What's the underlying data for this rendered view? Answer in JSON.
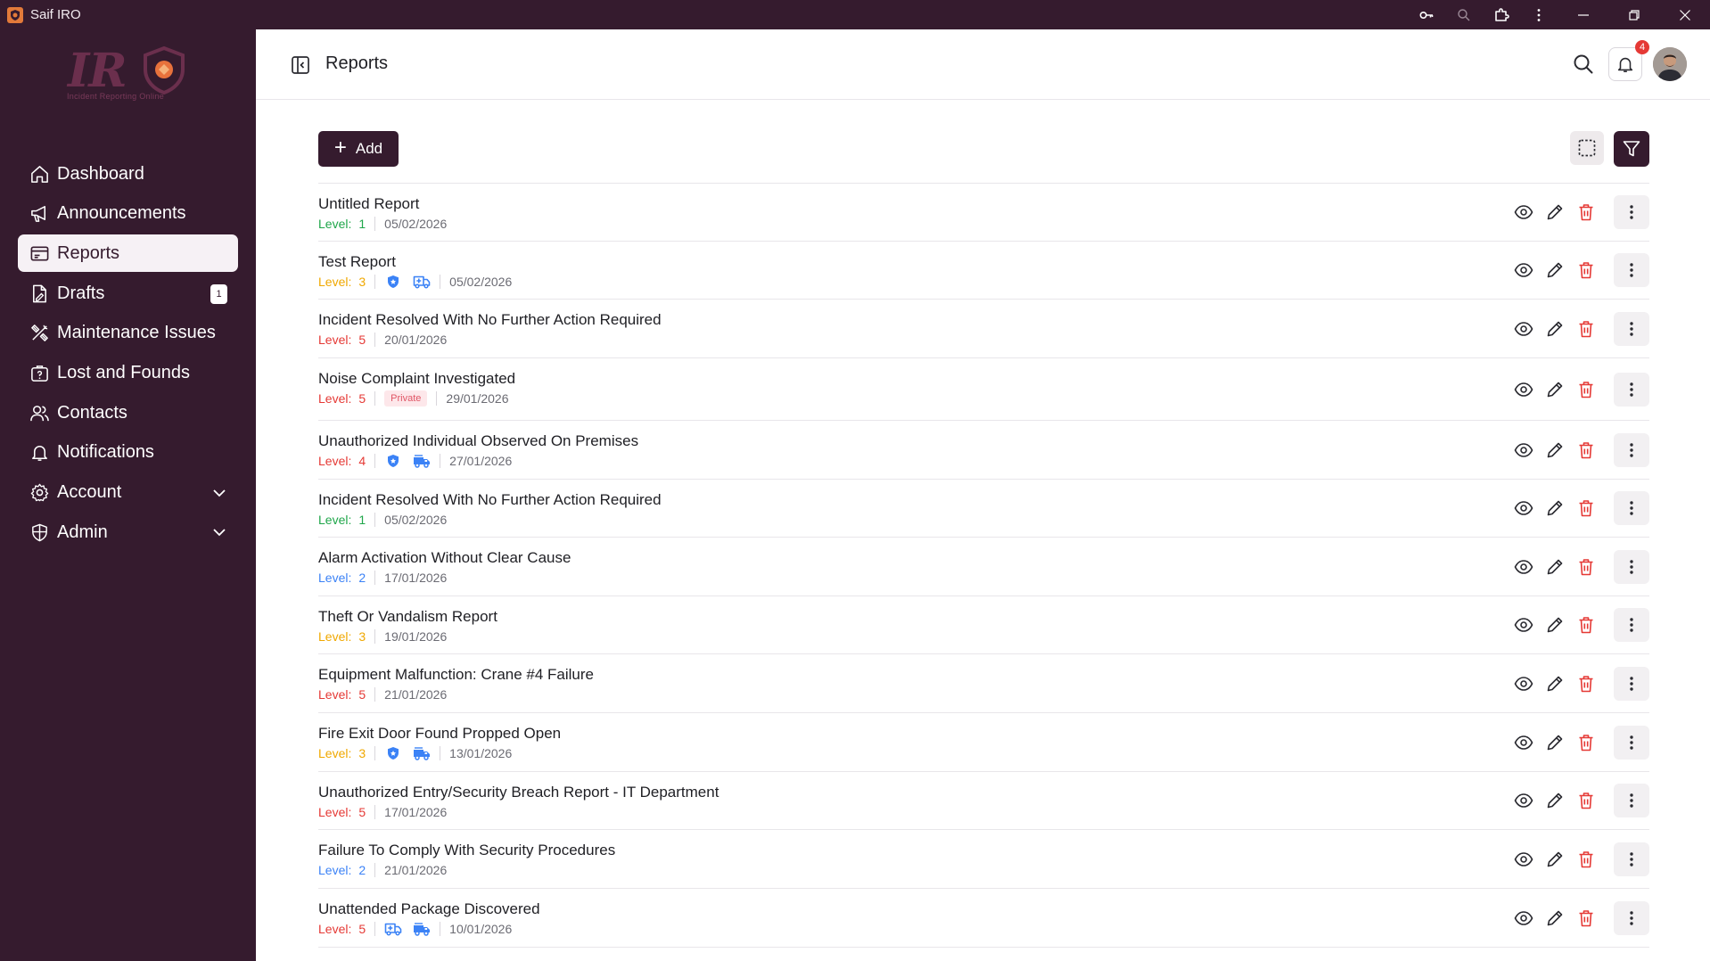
{
  "window": {
    "title": "Saif IRO"
  },
  "logo": {
    "text": "IR",
    "subtitle": "Incident Reporting Online"
  },
  "nav": {
    "items": [
      {
        "label": "Dashboard",
        "icon": "home-icon"
      },
      {
        "label": "Announcements",
        "icon": "megaphone-icon"
      },
      {
        "label": "Reports",
        "icon": "report-card-icon",
        "active": true
      },
      {
        "label": "Drafts",
        "icon": "draft-file-icon",
        "badge": "1"
      },
      {
        "label": "Maintenance Issues",
        "icon": "tools-icon"
      },
      {
        "label": "Lost and Founds",
        "icon": "question-bag-icon"
      },
      {
        "label": "Contacts",
        "icon": "users-icon"
      },
      {
        "label": "Notifications",
        "icon": "bell-icon"
      },
      {
        "label": "Account",
        "icon": "gear-icon",
        "expandable": true
      },
      {
        "label": "Admin",
        "icon": "shield-icon",
        "expandable": true
      }
    ]
  },
  "header": {
    "title": "Reports",
    "notification_count": "4"
  },
  "toolbar": {
    "add_label": "Add"
  },
  "level_label": "Level:",
  "colors": {
    "brand": "#351b2e",
    "level_1": "#1fa64a",
    "level_2": "#3b82f6",
    "level_3": "#f0a800",
    "level_4": "#e53935",
    "level_5": "#e53935",
    "delete": "#e53935"
  },
  "reports": [
    {
      "title": "Untitled Report",
      "level": "1",
      "date": "05/02/2026",
      "icons": [],
      "private": false
    },
    {
      "title": "Test Report",
      "level": "3",
      "date": "05/02/2026",
      "icons": [
        "police-shield-icon",
        "ambulance-icon"
      ],
      "private": false
    },
    {
      "title": "Incident Resolved With No Further Action Required",
      "level": "5",
      "date": "20/01/2026",
      "icons": [],
      "private": false
    },
    {
      "title": "Noise Complaint Investigated",
      "level": "5",
      "date": "29/01/2026",
      "icons": [],
      "private": true,
      "private_label": "Private"
    },
    {
      "title": "Unauthorized Individual Observed On Premises",
      "level": "4",
      "date": "27/01/2026",
      "icons": [
        "police-shield-icon",
        "fire-truck-icon"
      ],
      "private": false
    },
    {
      "title": "Incident Resolved With No Further Action Required",
      "level": "1",
      "date": "05/02/2026",
      "icons": [],
      "private": false
    },
    {
      "title": "Alarm Activation Without Clear Cause",
      "level": "2",
      "date": "17/01/2026",
      "icons": [],
      "private": false
    },
    {
      "title": "Theft Or Vandalism Report",
      "level": "3",
      "date": "19/01/2026",
      "icons": [],
      "private": false
    },
    {
      "title": "Equipment Malfunction: Crane #4 Failure",
      "level": "5",
      "date": "21/01/2026",
      "icons": [],
      "private": false
    },
    {
      "title": "Fire Exit Door Found Propped Open",
      "level": "3",
      "date": "13/01/2026",
      "icons": [
        "police-shield-icon",
        "fire-truck-icon"
      ],
      "private": false
    },
    {
      "title": "Unauthorized Entry/Security Breach Report - IT Department",
      "level": "5",
      "date": "17/01/2026",
      "icons": [],
      "private": false
    },
    {
      "title": "Failure To Comply With Security Procedures",
      "level": "2",
      "date": "21/01/2026",
      "icons": [],
      "private": false
    },
    {
      "title": "Unattended Package Discovered",
      "level": "5",
      "date": "10/01/2026",
      "icons": [
        "ambulance-icon",
        "fire-truck-icon"
      ],
      "private": false
    }
  ]
}
